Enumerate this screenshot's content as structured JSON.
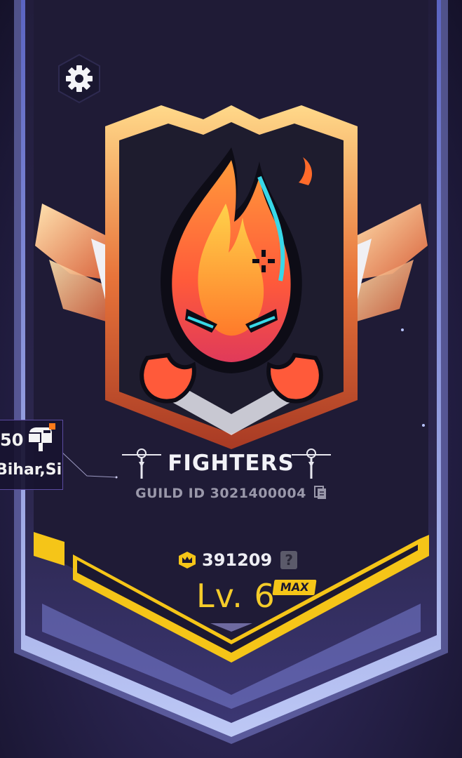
{
  "guild": {
    "name": "FIGHTERS",
    "id_label": "GUILD ID 3021400004",
    "score": "391209",
    "level": "Lv. 6",
    "max_badge": "MAX"
  },
  "member_card": {
    "count": "50",
    "location": "Bihar,Si"
  },
  "help_label": "?",
  "icons": {
    "settings": "gear-icon",
    "copy": "copy-icon",
    "score": "crown-icon",
    "help": "question-icon",
    "mail": "mailbox-icon",
    "emblem": "flame-emblem"
  },
  "colors": {
    "accent_gold": "#f5c518",
    "level_text": "#f5cc2a",
    "banner": "#2b2748",
    "notification": "#ff7a1a"
  }
}
